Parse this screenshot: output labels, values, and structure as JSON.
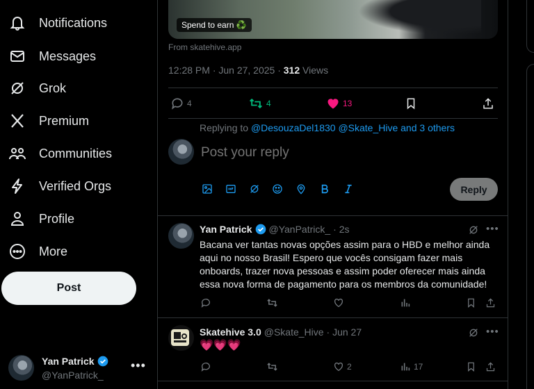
{
  "sidebar": {
    "items": [
      {
        "label": "Notifications",
        "icon": "bell-icon"
      },
      {
        "label": "Messages",
        "icon": "envelope-icon"
      },
      {
        "label": "Grok",
        "icon": "grok-icon"
      },
      {
        "label": "Premium",
        "icon": "x-logo-icon"
      },
      {
        "label": "Communities",
        "icon": "people-icon"
      },
      {
        "label": "Verified Orgs",
        "icon": "lightning-icon"
      },
      {
        "label": "Profile",
        "icon": "person-icon"
      },
      {
        "label": "More",
        "icon": "more-circle-icon"
      }
    ],
    "post_label": "Post",
    "account": {
      "name": "Yan Patrick",
      "handle": "@YanPatrick_",
      "more": "•••"
    }
  },
  "tweet": {
    "media_badge": "Spend to earn ♻️",
    "source": "From skatehive.app",
    "time": "12:28 PM · Jun 27, 2025 · ",
    "views": "312",
    "views_label": " Views",
    "stats": {
      "replies": "4",
      "reposts": "4",
      "likes": "13"
    }
  },
  "reply_compose": {
    "replying_prefix": "Replying to ",
    "replying_to": "@DesouzaDel1830 @Skate_Hive and 3 others",
    "placeholder": "Post your reply",
    "reply_label": "Reply"
  },
  "replies": [
    {
      "name": "Yan Patrick",
      "handle": "@YanPatrick_",
      "time": "· 2s",
      "text": "Bacana ver tantas novas opções assim para o HBD e melhor ainda aqui no nosso Brasil! Espero que vocês consigam fazer mais onboards, trazer nova pessoas e assim poder oferecer mais ainda essa nova forma de pagamento para os membros da comunidade!",
      "likes": "",
      "views": ""
    },
    {
      "name": "Skatehive 3.0",
      "handle": "@Skate_Hive",
      "time": "· Jun 27",
      "text": "💗💗💗",
      "likes": "2",
      "views": "17"
    }
  ],
  "colors": {
    "accent": "#1d9bf0",
    "repost": "#00ba7c",
    "like": "#f91880",
    "verified": "#1d9bf0"
  }
}
